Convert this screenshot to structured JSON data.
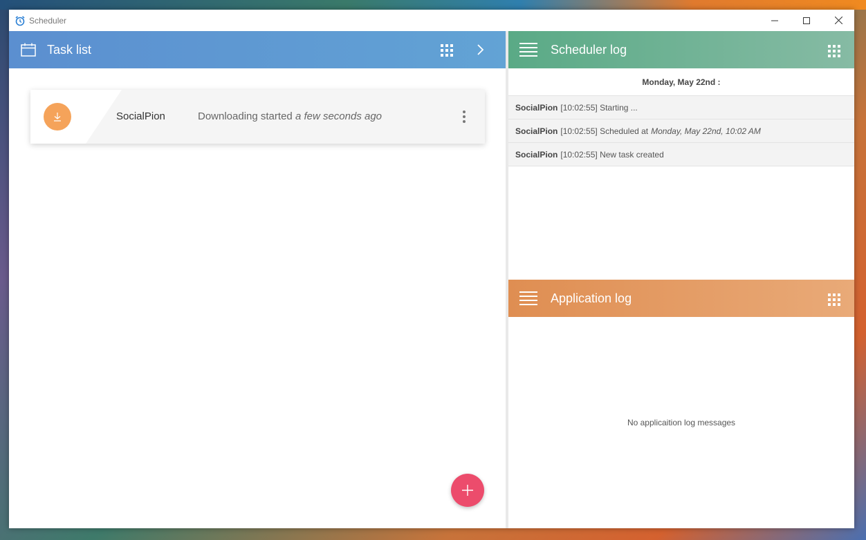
{
  "window": {
    "title": "Scheduler"
  },
  "task_list": {
    "title": "Task list",
    "tasks": [
      {
        "name": "SocialPion",
        "status_prefix": "Downloading started",
        "status_time": "a few seconds ago",
        "icon": "download-icon",
        "color": "#f5a35a"
      }
    ],
    "fab_icon": "plus-icon",
    "fab_color": "#ec4c6c",
    "header_color": "#5b8fd0"
  },
  "scheduler_log": {
    "title": "Scheduler log",
    "date": "Monday, May 22nd :",
    "entries": [
      {
        "source": "SocialPion",
        "text": "[10:02:55] Starting ...",
        "emphasis": ""
      },
      {
        "source": "SocialPion",
        "text": "[10:02:55] Scheduled at",
        "emphasis": "Monday, May 22nd, 10:02 AM"
      },
      {
        "source": "SocialPion",
        "text": "[10:02:55] New task created",
        "emphasis": ""
      }
    ],
    "header_color": "#5aaa86"
  },
  "application_log": {
    "title": "Application log",
    "empty_message": "No applicaition log messages",
    "header_color": "#df8e52"
  }
}
